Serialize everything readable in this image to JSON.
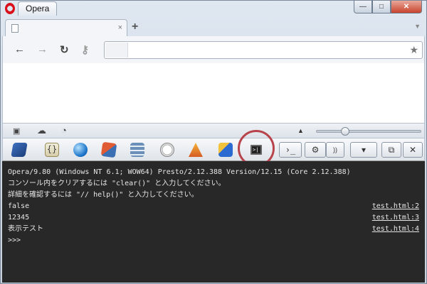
{
  "window": {
    "title": "Opera",
    "buttons": {
      "minimize": "—",
      "maximize": "□",
      "close": "✕"
    }
  },
  "tabs": {
    "close_icon": "×",
    "new_tab": "+",
    "menu": "▼"
  },
  "nav": {
    "back": "←",
    "forward": "→",
    "reload": "↻",
    "wand": "⚷",
    "url_value": "",
    "bookmark_star": "★"
  },
  "statusbar": {
    "panel_icon": "▣",
    "cloud_icon": "☁",
    "speed_icon": "◔",
    "zoom_arrow": "▲",
    "zoom_level": 0.25
  },
  "dragonfly": {
    "tools": [
      "dom-icon",
      "scripts-icon",
      "network-icon",
      "resources-icon",
      "storage-icon",
      "profiler-icon",
      "errors-icon",
      "utilities-icon",
      "console-icon"
    ],
    "right_buttons": {
      "command_line": "›_",
      "settings": "⚙",
      "speak": "))",
      "menu": "▾",
      "undock": "⧉",
      "close": "✕"
    },
    "highlight_color": "#b8434a"
  },
  "console": {
    "lines": [
      {
        "text": "Opera/9.80 (Windows NT 6.1; WOW64) Presto/2.12.388 Version/12.15 (Core 2.12.388)",
        "source": ""
      },
      {
        "text": "コンソール内をクリアするには \"clear()\" と入力してください。",
        "source": ""
      },
      {
        "text": "詳細を確認するには \"// help()\" と入力してください。",
        "source": ""
      },
      {
        "text": "false",
        "source": "test.html:2"
      },
      {
        "text": "12345",
        "source": "test.html:3"
      },
      {
        "text": "表示テスト",
        "source": "test.html:4"
      },
      {
        "text": ">>>",
        "source": ""
      }
    ]
  }
}
